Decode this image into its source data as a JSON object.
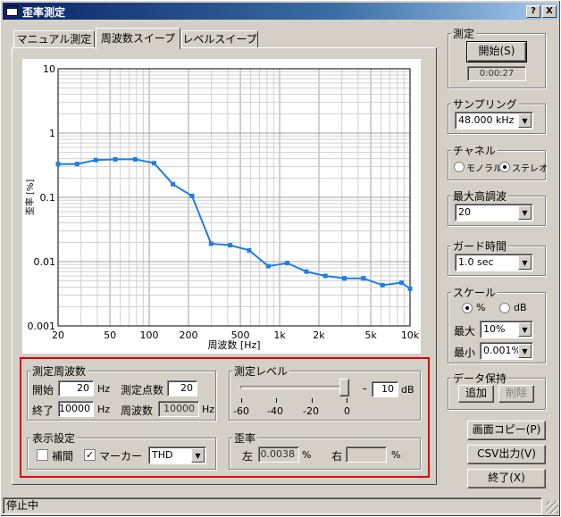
{
  "window": {
    "title": "歪率測定",
    "help_btn": "?",
    "close_btn": "X"
  },
  "tabs": [
    {
      "label": "マニュアル測定"
    },
    {
      "label": "周波数スイープ"
    },
    {
      "label": "レベルスイープ"
    }
  ],
  "measure": {
    "group_label": "測定",
    "start_button": "開始(S)",
    "elapsed": "0:00:27"
  },
  "sampling": {
    "group_label": "サンプリング",
    "value": "48.000 kHz"
  },
  "channel": {
    "group_label": "チャネル",
    "mono": "モノラル",
    "stereo": "ステレオ",
    "selected": "stereo"
  },
  "max_harmonic": {
    "group_label": "最大高調波",
    "value": "20"
  },
  "guard_time": {
    "group_label": "ガード時間",
    "value": "1.0 sec"
  },
  "scale": {
    "group_label": "スケール",
    "percent": "%",
    "db": "dB",
    "selected": "percent",
    "max_label": "最大",
    "max_value": "10%",
    "min_label": "最小",
    "min_value": "0.001%"
  },
  "data_hold": {
    "group_label": "データ保持",
    "add": "追加",
    "delete": "削除"
  },
  "buttons": {
    "screen_copy": "画面コピー(P)",
    "csv": "CSV出力(V)",
    "exit": "終了(X)"
  },
  "freq": {
    "group_label": "測定周波数",
    "start_label": "開始",
    "start": "20",
    "hz1": "Hz",
    "points_label": "測定点数",
    "points": "20",
    "end_label": "終了",
    "end": "10000",
    "hz2": "Hz",
    "current_label": "周波数",
    "current": "10000",
    "hz3": "Hz"
  },
  "level": {
    "group_label": "測定レベル",
    "value": "10",
    "unit": "dB",
    "minus": "-",
    "ticks": [
      "-60",
      "-40",
      "-20",
      "0"
    ],
    "slider_db": -2
  },
  "display": {
    "group_label": "表示設定",
    "interp_label": "補間",
    "interp_checked": false,
    "marker_label": "マーカー",
    "marker_checked": true,
    "mode": "THD"
  },
  "distortion": {
    "group_label": "歪率",
    "left_label": "左",
    "left_value": "0.0038",
    "pct1": "%",
    "right_label": "右",
    "right_value": "",
    "pct2": "%"
  },
  "status": {
    "text": "停止中"
  },
  "chart_data": {
    "type": "line",
    "xscale": "log",
    "yscale": "log",
    "xlim": [
      20,
      10000
    ],
    "ylim": [
      0.001,
      10
    ],
    "xlabel": "周波数 [Hz]",
    "ylabel": "歪率 [%]",
    "xticks": [
      {
        "v": 20,
        "t": "20"
      },
      {
        "v": 50,
        "t": "50"
      },
      {
        "v": 100,
        "t": "100"
      },
      {
        "v": 200,
        "t": "200"
      },
      {
        "v": 500,
        "t": "500"
      },
      {
        "v": 1000,
        "t": "1k"
      },
      {
        "v": 2000,
        "t": "2k"
      },
      {
        "v": 5000,
        "t": "5k"
      },
      {
        "v": 10000,
        "t": "10k"
      }
    ],
    "yticks": [
      {
        "v": 10,
        "t": "10"
      },
      {
        "v": 1,
        "t": "1"
      },
      {
        "v": 0.1,
        "t": "0.1"
      },
      {
        "v": 0.01,
        "t": "0.01"
      },
      {
        "v": 0.001,
        "t": "0.001"
      }
    ],
    "grid": true,
    "color": "#1e7fe0",
    "series": [
      {
        "x": [
          20,
          28,
          39,
          55,
          78,
          109,
          152,
          213,
          298,
          417,
          584,
          818,
          1145,
          1602,
          2242,
          3139,
          4393,
          6149,
          8607,
          10000
        ],
        "y": [
          0.33,
          0.33,
          0.38,
          0.39,
          0.39,
          0.34,
          0.16,
          0.105,
          0.019,
          0.018,
          0.015,
          0.0085,
          0.0095,
          0.007,
          0.006,
          0.0055,
          0.0055,
          0.0043,
          0.0047,
          0.0038
        ]
      }
    ]
  }
}
